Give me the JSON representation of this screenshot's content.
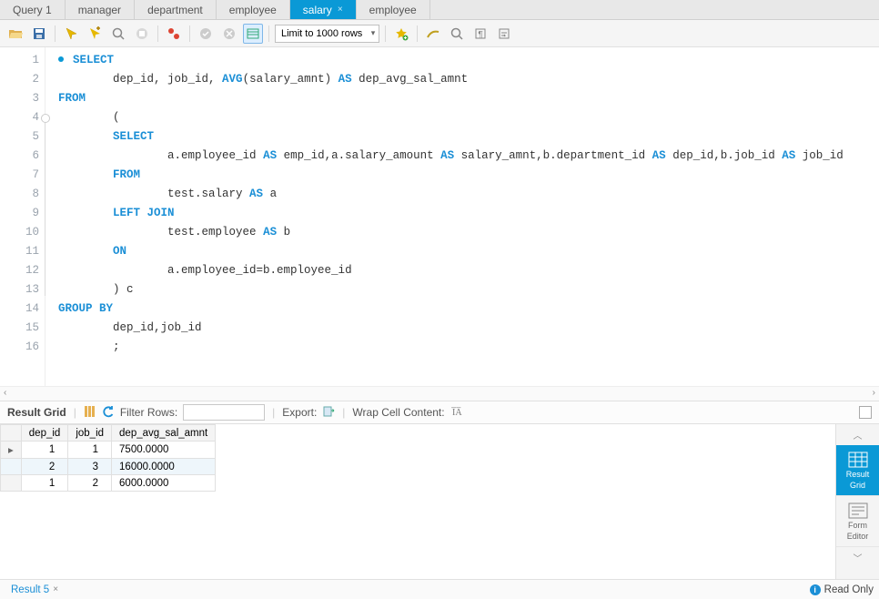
{
  "tabs": [
    {
      "label": "Query 1",
      "closable": false,
      "active": false
    },
    {
      "label": "manager",
      "closable": false,
      "active": false
    },
    {
      "label": "department",
      "closable": false,
      "active": false
    },
    {
      "label": "employee",
      "closable": false,
      "active": false
    },
    {
      "label": "salary",
      "closable": true,
      "active": true
    },
    {
      "label": "employee",
      "closable": false,
      "active": false
    }
  ],
  "toolbar": {
    "limit_label": "Limit to 1000 rows"
  },
  "editor": {
    "line_count": 16,
    "tokens": [
      [
        {
          "t": "dot"
        },
        {
          "t": "kw",
          "s": "SELECT"
        }
      ],
      [
        {
          "t": "sp",
          "n": 2
        },
        {
          "t": "txt",
          "s": "dep_id, job_id, "
        },
        {
          "t": "kw",
          "s": "AVG"
        },
        {
          "t": "txt",
          "s": "(salary_amnt) "
        },
        {
          "t": "kw",
          "s": "AS"
        },
        {
          "t": "txt",
          "s": " dep_avg_sal_amnt"
        }
      ],
      [
        {
          "t": "kw",
          "s": "FROM"
        }
      ],
      [
        {
          "t": "sp",
          "n": 2
        },
        {
          "t": "txt",
          "s": "("
        }
      ],
      [
        {
          "t": "sp",
          "n": 2
        },
        {
          "t": "kw",
          "s": "SELECT"
        }
      ],
      [
        {
          "t": "sp",
          "n": 4
        },
        {
          "t": "txt",
          "s": "a.employee_id "
        },
        {
          "t": "kw",
          "s": "AS"
        },
        {
          "t": "txt",
          "s": " emp_id,a.salary_amount "
        },
        {
          "t": "kw",
          "s": "AS"
        },
        {
          "t": "txt",
          "s": " salary_amnt,b.department_id "
        },
        {
          "t": "kw",
          "s": "AS"
        },
        {
          "t": "txt",
          "s": " dep_id,b.job_id "
        },
        {
          "t": "kw",
          "s": "AS"
        },
        {
          "t": "txt",
          "s": " job_id"
        }
      ],
      [
        {
          "t": "sp",
          "n": 2
        },
        {
          "t": "kw",
          "s": "FROM"
        }
      ],
      [
        {
          "t": "sp",
          "n": 4
        },
        {
          "t": "txt",
          "s": "test.salary "
        },
        {
          "t": "kw",
          "s": "AS"
        },
        {
          "t": "txt",
          "s": " a"
        }
      ],
      [
        {
          "t": "sp",
          "n": 2
        },
        {
          "t": "kw",
          "s": "LEFT JOIN"
        }
      ],
      [
        {
          "t": "sp",
          "n": 4
        },
        {
          "t": "txt",
          "s": "test.employee "
        },
        {
          "t": "kw",
          "s": "AS"
        },
        {
          "t": "txt",
          "s": " b"
        }
      ],
      [
        {
          "t": "sp",
          "n": 2
        },
        {
          "t": "kw",
          "s": "ON"
        }
      ],
      [
        {
          "t": "sp",
          "n": 4
        },
        {
          "t": "txt",
          "s": "a.employee_id=b.employee_id"
        }
      ],
      [
        {
          "t": "sp",
          "n": 2
        },
        {
          "t": "txt",
          "s": ") c"
        }
      ],
      [
        {
          "t": "kw",
          "s": "GROUP BY"
        }
      ],
      [
        {
          "t": "sp",
          "n": 2
        },
        {
          "t": "txt",
          "s": "dep_id,job_id"
        }
      ],
      [
        {
          "t": "sp",
          "n": 2
        },
        {
          "t": "txt",
          "s": ";"
        }
      ]
    ]
  },
  "result_toolbar": {
    "title": "Result Grid",
    "filter_label": "Filter Rows:",
    "export_label": "Export:",
    "wrap_label": "Wrap Cell Content:"
  },
  "result_grid": {
    "columns": [
      "dep_id",
      "job_id",
      "dep_avg_sal_amnt"
    ],
    "rows": [
      {
        "cells": [
          "1",
          "1",
          "7500.0000"
        ],
        "current": true
      },
      {
        "cells": [
          "2",
          "3",
          "16000.0000"
        ],
        "selected": true
      },
      {
        "cells": [
          "1",
          "2",
          "6000.0000"
        ]
      }
    ]
  },
  "side_panel": {
    "items": [
      {
        "label_line1": "Result",
        "label_line2": "Grid",
        "active": true
      },
      {
        "label_line1": "Form",
        "label_line2": "Editor",
        "active": false
      }
    ]
  },
  "bottom": {
    "tab_label": "Result 5",
    "readonly_label": "Read Only"
  }
}
